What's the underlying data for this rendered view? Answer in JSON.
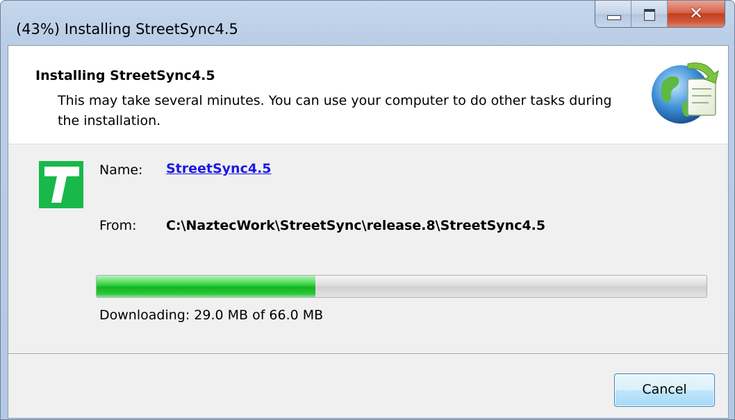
{
  "window": {
    "title": "(43%) Installing StreetSync4.5"
  },
  "header": {
    "title": "Installing StreetSync4.5",
    "description": "This may take several minutes. You can use your computer to do other tasks during the installation."
  },
  "details": {
    "name_label": "Name:",
    "name_value": "StreetSync4.5",
    "from_label": "From:",
    "from_value": "C:\\NaztecWork\\StreetSync\\release.8\\StreetSync4.5"
  },
  "progress": {
    "fraction": 0.3591,
    "status_text": "Downloading: 29.0 MB of 66.0 MB"
  },
  "buttons": {
    "cancel_label": "Cancel"
  },
  "icons": {
    "app": "green-t-app-icon",
    "header": "globe-install-icon"
  }
}
